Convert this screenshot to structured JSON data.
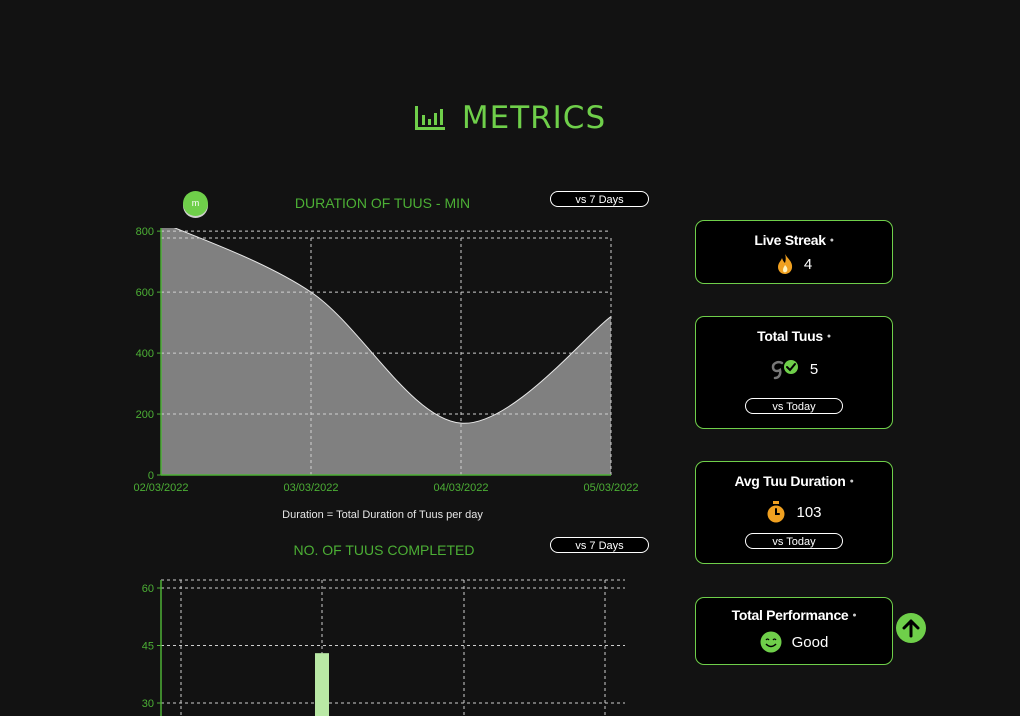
{
  "page": {
    "title": "METRICS"
  },
  "duration_chart": {
    "title": "DURATION OF TUUS - MIN",
    "compare_label": "vs 7 Days",
    "badge": "m",
    "caption": "Duration = Total Duration of Tuus per day"
  },
  "completed_chart": {
    "title": "NO. OF TUUS COMPLETED",
    "compare_label": "vs 7 Days"
  },
  "cards": {
    "live_streak": {
      "title": "Live Streak",
      "value": "4"
    },
    "total_tuus": {
      "title": "Total Tuus",
      "value": "5",
      "compare_label": "vs Today"
    },
    "avg_duration": {
      "title": "Avg Tuu Duration",
      "value": "103",
      "compare_label": "vs Today"
    },
    "performance": {
      "title": "Total Performance",
      "value": "Good"
    }
  },
  "colors": {
    "accent": "#6fcf4a",
    "axis": "#4caf35",
    "area_fill": "#808080",
    "bar_fill": "#b9e8a5",
    "background": "#121212"
  },
  "chart_data": [
    {
      "type": "area",
      "title": "DURATION OF TUUS - MIN",
      "x": [
        "02/03/2022",
        "03/03/2022",
        "04/03/2022",
        "05/03/2022"
      ],
      "series": [
        {
          "values": [
            830,
            600,
            170,
            520
          ]
        }
      ],
      "ylim": [
        0,
        830
      ],
      "yticks": [
        0,
        200,
        400,
        600,
        800
      ],
      "grid": true
    },
    {
      "type": "bar",
      "title": "NO. OF TUUS COMPLETED",
      "categories": [
        "",
        "",
        "",
        ""
      ],
      "values": [
        0,
        43,
        0,
        0
      ],
      "ylim": [
        30,
        60
      ],
      "yticks": [
        30,
        45,
        60
      ],
      "grid": true
    }
  ]
}
